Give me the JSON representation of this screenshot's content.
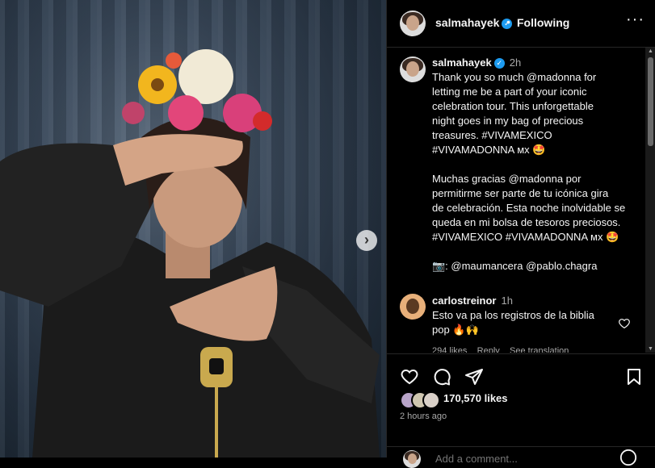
{
  "post": {
    "username": "salmahayek",
    "follow_status": "Following",
    "separator": "•",
    "more_label": "···"
  },
  "caption": {
    "username": "salmahayek",
    "time": "2h",
    "en_lines": [
      "Thank you so much @madonna for",
      "letting me be a part of your iconic",
      "celebration tour. This unforgettable",
      "night goes in my bag of precious",
      "treasures. #VIVAMEXICO",
      "#VIVAMADONNA ᴍx 🤩"
    ],
    "es_lines": [
      "Muchas gracias @madonna por",
      "permitirme ser parte de tu icónica gira",
      "de celebración. Esta noche inolvidable se",
      "queda en mi bolsa de tesoros preciosos.",
      "#VIVAMEXICO #VIVAMADONNA ᴍx 🤩"
    ],
    "credit": "📷: @maumancera @pablo.chagra"
  },
  "comment": {
    "username": "carlostreinor",
    "time": "1h",
    "text_lines": [
      "Esto va pa los registros de la biblia",
      "pop 🔥🙌"
    ],
    "likes": "294 likes",
    "reply": "Reply",
    "see_translation": "See translation"
  },
  "footer": {
    "likes_count": "170,570 likes",
    "posted": "2 hours ago",
    "add_comment_placeholder": "Add a comment..."
  },
  "icons": [
    "heart-icon",
    "comment-icon",
    "share-icon",
    "bookmark-icon",
    "verified-icon",
    "chevron-right-icon"
  ],
  "colors": {
    "background": "#000000",
    "text": "#f5f5f5",
    "muted": "#a8a8a8",
    "verified": "#1d9bf0",
    "divider": "#262626"
  }
}
